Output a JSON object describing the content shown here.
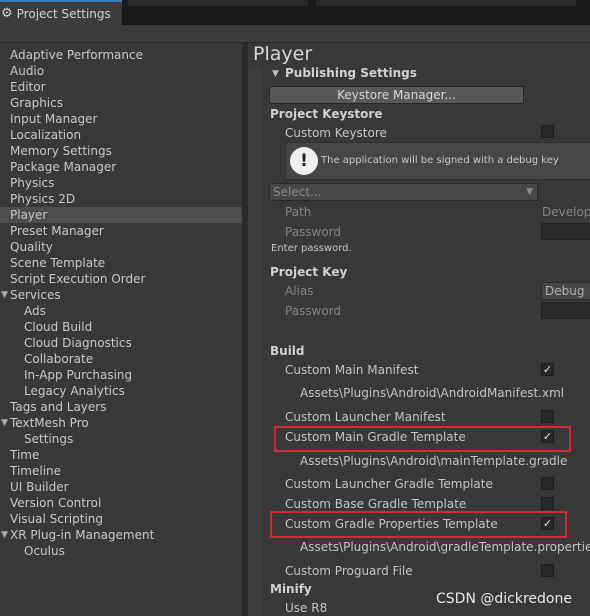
{
  "window": {
    "tab_title": "Project Settings",
    "tab_icon": "gear-icon"
  },
  "sidebar": {
    "items": [
      {
        "label": "Adaptive Performance"
      },
      {
        "label": "Audio"
      },
      {
        "label": "Editor"
      },
      {
        "label": "Graphics"
      },
      {
        "label": "Input Manager"
      },
      {
        "label": "Localization"
      },
      {
        "label": "Memory Settings"
      },
      {
        "label": "Package Manager"
      },
      {
        "label": "Physics"
      },
      {
        "label": "Physics 2D"
      },
      {
        "label": "Player",
        "selected": true
      },
      {
        "label": "Preset Manager"
      },
      {
        "label": "Quality"
      },
      {
        "label": "Scene Template"
      },
      {
        "label": "Script Execution Order"
      },
      {
        "label": "Services",
        "foldout": true
      },
      {
        "label": "Ads",
        "child": true
      },
      {
        "label": "Cloud Build",
        "child": true
      },
      {
        "label": "Cloud Diagnostics",
        "child": true
      },
      {
        "label": "Collaborate",
        "child": true
      },
      {
        "label": "In-App Purchasing",
        "child": true
      },
      {
        "label": "Legacy Analytics",
        "child": true
      },
      {
        "label": "Tags and Layers"
      },
      {
        "label": "TextMesh Pro",
        "foldout": true
      },
      {
        "label": "Settings",
        "child": true
      },
      {
        "label": "Time"
      },
      {
        "label": "Timeline"
      },
      {
        "label": "UI Builder"
      },
      {
        "label": "Version Control"
      },
      {
        "label": "Visual Scripting"
      },
      {
        "label": "XR Plug-in Management",
        "foldout": true
      },
      {
        "label": "Oculus",
        "child": true
      }
    ]
  },
  "main": {
    "title": "Player",
    "publishing": {
      "header": "Publishing Settings",
      "keystore_manager_button": "Keystore Manager...",
      "project_keystore_header": "Project Keystore",
      "custom_keystore_label": "Custom Keystore",
      "custom_keystore_checked": false,
      "help_text": "The application will be signed with a debug key",
      "select_placeholder": "Select...",
      "path_label": "Path",
      "path_value": "Develop",
      "password_label": "Password",
      "password_hint": "Enter password.",
      "project_key_header": "Project Key",
      "alias_label": "Alias",
      "alias_value": "Debug",
      "key_password_label": "Password"
    },
    "build": {
      "header": "Build",
      "custom_main_manifest": {
        "label": "Custom Main Manifest",
        "checked": true,
        "path": "Assets\\Plugins\\Android\\AndroidManifest.xml"
      },
      "custom_launcher_manifest": {
        "label": "Custom Launcher Manifest",
        "checked": false
      },
      "custom_main_gradle": {
        "label": "Custom Main Gradle Template",
        "checked": true,
        "path": "Assets\\Plugins\\Android\\mainTemplate.gradle"
      },
      "custom_launcher_gradle": {
        "label": "Custom Launcher Gradle Template",
        "checked": false
      },
      "custom_base_gradle": {
        "label": "Custom Base Gradle Template",
        "checked": false
      },
      "custom_gradle_properties": {
        "label": "Custom Gradle Properties Template",
        "checked": true,
        "path": "Assets\\Plugins\\Android\\gradleTemplate.properties"
      },
      "custom_proguard": {
        "label": "Custom Proguard File",
        "checked": false
      }
    },
    "minify": {
      "header": "Minify",
      "use_r8_label": "Use R8"
    }
  },
  "watermark": "CSDN @dickredone",
  "colors": {
    "highlight_border": "#d8272f",
    "selected_item_bg": "#4d4d4d",
    "tab_accent": "#3a79bb"
  }
}
